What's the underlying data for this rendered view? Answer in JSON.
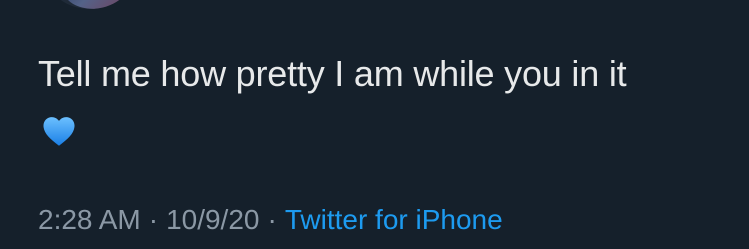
{
  "tweet": {
    "text": "Tell me how pretty I am while you in it",
    "emoji_icon": "blue-heart-icon",
    "time": "2:28 AM",
    "separator": "·",
    "date": "10/9/20",
    "source": "Twitter for iPhone"
  },
  "colors": {
    "background": "#15202b",
    "text": "#e7e9ea",
    "meta": "#8b98a5",
    "link": "#1d9bf0",
    "heart": "#3ea2ff"
  }
}
